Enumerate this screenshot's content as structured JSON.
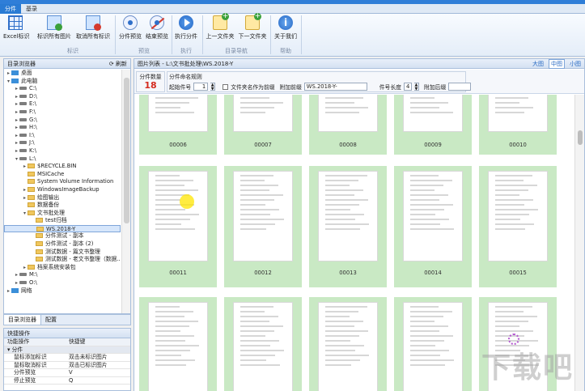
{
  "ribbon": {
    "tabs": [
      "分件",
      "基录"
    ],
    "buttons": {
      "excel": "Excel标识",
      "mark_all": "标识所有图片",
      "unmark_all": "取消所有标识",
      "preview": "分件预览",
      "end_preview": "结束预览",
      "execute": "执行分件",
      "prev_folder": "上一文件夹",
      "next_folder": "下一文件夹",
      "about": "关于我们"
    },
    "groups": {
      "mark": "标识",
      "preview": "预览",
      "execute": "执行",
      "nav": "目录导航",
      "help": "帮助"
    }
  },
  "explorer": {
    "title": "目录浏览器",
    "refresh": "刷新",
    "tree": [
      {
        "label": "桌面",
        "level": 0,
        "icon": "pc",
        "arrow": "▸"
      },
      {
        "label": "此电脑",
        "level": 0,
        "icon": "pc",
        "arrow": "▾"
      },
      {
        "label": "C:\\",
        "level": 1,
        "icon": "drive",
        "arrow": "▸"
      },
      {
        "label": "D:\\",
        "level": 1,
        "icon": "drive",
        "arrow": "▸"
      },
      {
        "label": "E:\\",
        "level": 1,
        "icon": "drive",
        "arrow": "▸"
      },
      {
        "label": "F:\\",
        "level": 1,
        "icon": "drive",
        "arrow": "▸"
      },
      {
        "label": "G:\\",
        "level": 1,
        "icon": "drive",
        "arrow": "▸"
      },
      {
        "label": "H:\\",
        "level": 1,
        "icon": "drive",
        "arrow": "▸"
      },
      {
        "label": "I:\\",
        "level": 1,
        "icon": "drive",
        "arrow": "▸"
      },
      {
        "label": "J:\\",
        "level": 1,
        "icon": "drive",
        "arrow": "▸"
      },
      {
        "label": "K:\\",
        "level": 1,
        "icon": "drive",
        "arrow": "▸"
      },
      {
        "label": "L:\\",
        "level": 1,
        "icon": "drive",
        "arrow": "▾"
      },
      {
        "label": "$RECYCLE.BIN",
        "level": 2,
        "icon": "fold",
        "arrow": "▸"
      },
      {
        "label": "MSICache",
        "level": 2,
        "icon": "fold",
        "arrow": ""
      },
      {
        "label": "System Volume Information",
        "level": 2,
        "icon": "fold",
        "arrow": ""
      },
      {
        "label": "WindowsImageBackup",
        "level": 2,
        "icon": "fold",
        "arrow": "▸"
      },
      {
        "label": "绘图输出",
        "level": 2,
        "icon": "fold",
        "arrow": "▸"
      },
      {
        "label": "数据备份",
        "level": 2,
        "icon": "fold",
        "arrow": ""
      },
      {
        "label": "文书批处理",
        "level": 2,
        "icon": "fold",
        "arrow": "▾"
      },
      {
        "label": "test归档",
        "level": 3,
        "icon": "fold",
        "arrow": ""
      },
      {
        "label": "WS.2018-Y",
        "level": 3,
        "icon": "fold",
        "arrow": "",
        "selected": true
      },
      {
        "label": "分件测试 - 副本",
        "level": 3,
        "icon": "fold",
        "arrow": ""
      },
      {
        "label": "分件测试 - 副本 (2)",
        "level": 3,
        "icon": "fold",
        "arrow": ""
      },
      {
        "label": "测试数据 - 篇文书整理",
        "level": 3,
        "icon": "fold",
        "arrow": ""
      },
      {
        "label": "测试数据 - 老文书整理（数据...",
        "level": 3,
        "icon": "fold",
        "arrow": ""
      },
      {
        "label": "档案系统安装包",
        "level": 2,
        "icon": "fold",
        "arrow": "▸"
      },
      {
        "label": "M:\\",
        "level": 1,
        "icon": "drive",
        "arrow": "▸"
      },
      {
        "label": "O:\\",
        "level": 1,
        "icon": "drive",
        "arrow": "▸"
      },
      {
        "label": "网络",
        "level": 0,
        "icon": "pc",
        "arrow": "▸"
      }
    ],
    "tabs": [
      "目录浏览器",
      "配置"
    ]
  },
  "shortcuts": {
    "title": "快捷操作",
    "col_action": "功能操作",
    "col_key": "快捷键",
    "group": "分件",
    "rows": [
      {
        "action": "鼠标添加标识",
        "key": "双击未标识图片"
      },
      {
        "action": "鼠标取消标识",
        "key": "双击已标识图片"
      },
      {
        "action": "分件预览",
        "key": "V"
      },
      {
        "action": "停止预览",
        "key": "Q"
      }
    ]
  },
  "main": {
    "header": "图片列表 - L:\\文书批处理\\WS.2018-Y",
    "views": {
      "large": "大图",
      "medium": "中图",
      "small": "小图"
    },
    "count_label": "分件数量",
    "count_value": "18",
    "rule_title": "分件命名规则",
    "start_label": "起始件号",
    "start_value": "1",
    "use_folder_prefix": "文件夹名作为前缀",
    "prefix_label": "附加前缀",
    "prefix_value": "WS.2018-Y-",
    "length_label": "件号长度",
    "length_value": "4",
    "suffix_label": "附加后缀",
    "suffix_value": ""
  },
  "thumbnails": {
    "row1": [
      "00006",
      "00007",
      "00008",
      "00009",
      "00010"
    ],
    "row2": [
      "00011",
      "00012",
      "00013",
      "00014",
      "00015"
    ],
    "row3": [
      "",
      "",
      "",
      "",
      ""
    ]
  },
  "colors": {
    "accent": "#2a7bd4",
    "marked_bg": "#c9e9c4",
    "count": "#d42a1e"
  }
}
